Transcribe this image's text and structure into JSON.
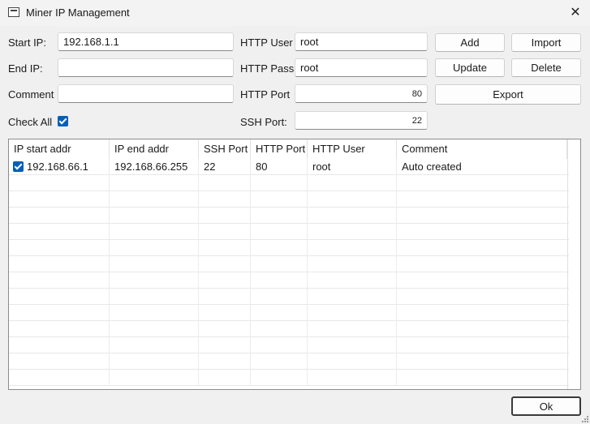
{
  "window": {
    "title": "Miner IP Management",
    "close_glyph": "✕"
  },
  "form": {
    "start_ip_label": "Start IP:",
    "start_ip_value": "192.168.1.1",
    "end_ip_label": "End IP:",
    "end_ip_value": "",
    "comment_label": "Comment",
    "comment_value": "",
    "check_all_label": "Check All",
    "check_all_checked": true,
    "http_user_label": "HTTP User",
    "http_user_value": "root",
    "http_pass_label": "HTTP Pass",
    "http_pass_value": "root",
    "http_port_label": "HTTP Port",
    "http_port_value": "80",
    "ssh_port_label": "SSH Port:",
    "ssh_port_value": "22"
  },
  "buttons": {
    "add": "Add",
    "import": "Import",
    "update": "Update",
    "delete": "Delete",
    "export": "Export",
    "ok": "Ok"
  },
  "table": {
    "columns": [
      "IP start addr",
      "IP end addr",
      "SSH Port",
      "HTTP Port",
      "HTTP User",
      "Comment"
    ],
    "rows": [
      {
        "checked": true,
        "cells": [
          "192.168.66.1",
          "192.168.66.255",
          "22",
          "80",
          "root",
          "Auto created"
        ]
      }
    ]
  }
}
